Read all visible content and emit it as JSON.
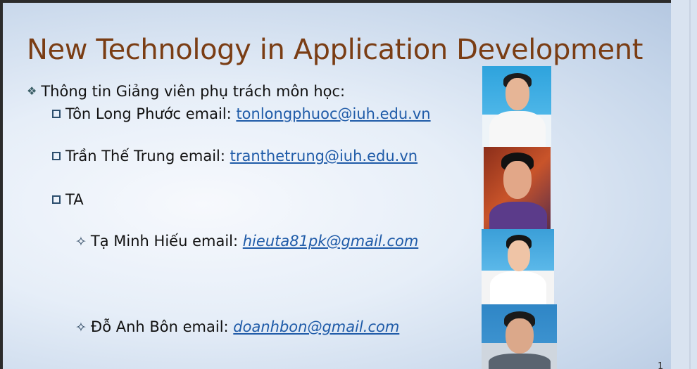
{
  "slide": {
    "title": "New Technology in Application Development",
    "intro": "Thông tin Giảng viên phụ trách môn học:",
    "lecturers": [
      {
        "label": "Tôn Long Phước email:",
        "email": "tonlongphuoc@iuh.edu.vn"
      },
      {
        "label": "Trần Thế Trung email:",
        "email": "tranthetrung@iuh.edu.vn"
      }
    ],
    "ta_label": "TA",
    "tas": [
      {
        "label": "Tạ Minh Hiếu email:",
        "email": "hieuta81pk@gmail.com"
      },
      {
        "label": "Đỗ Anh Bôn  email:",
        "email": "doanhbon@gmail.com"
      }
    ],
    "page_number": "1"
  },
  "colors": {
    "title": "#7a3d14",
    "link": "#1f5ba8",
    "bullet": "#2d4f6e"
  },
  "icons": {
    "intro_bullet": "diamond-bullet-icon",
    "lecturer_bullet": "checkbox-bullet-icon",
    "ta_bullet": "four-point-star-bullet-icon"
  }
}
